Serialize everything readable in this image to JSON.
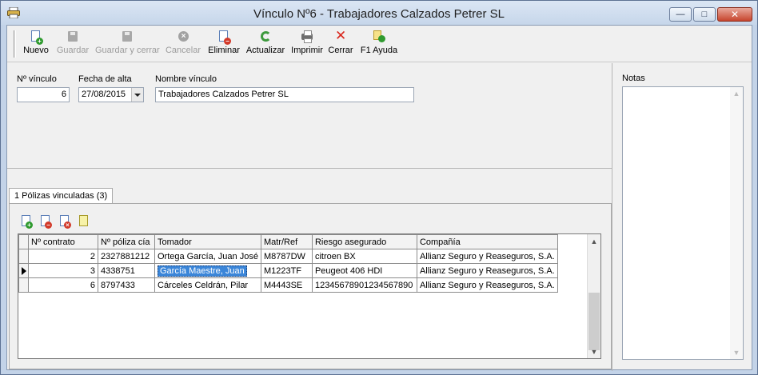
{
  "window": {
    "title": "Vínculo Nº6 - Trabajadores Calzados Petrer SL",
    "minimize_icon": "minimize-icon",
    "maximize_icon": "maximize-icon",
    "close_icon": "close-icon"
  },
  "toolbar": {
    "buttons": [
      {
        "key": "nuevo",
        "label": "Nuevo",
        "icon": "new-document-icon",
        "enabled": true
      },
      {
        "key": "guardar",
        "label": "Guardar",
        "icon": "save-icon",
        "enabled": false
      },
      {
        "key": "guardar_cerrar",
        "label": "Guardar y cerrar",
        "icon": "save-close-icon",
        "enabled": false
      },
      {
        "key": "cancelar",
        "label": "Cancelar",
        "icon": "cancel-icon",
        "enabled": false
      },
      {
        "key": "eliminar",
        "label": "Eliminar",
        "icon": "delete-document-icon",
        "enabled": true
      },
      {
        "key": "actualizar",
        "label": "Actualizar",
        "icon": "refresh-icon",
        "enabled": true
      },
      {
        "key": "imprimir",
        "label": "Imprimir",
        "icon": "printer-icon",
        "enabled": true
      },
      {
        "key": "cerrar",
        "label": "Cerrar",
        "icon": "close-red-x-icon",
        "enabled": true
      },
      {
        "key": "ayuda",
        "label": "F1 Ayuda",
        "icon": "help-icon",
        "enabled": true
      }
    ]
  },
  "form": {
    "num_vinculo_label": "Nº vínculo",
    "num_vinculo_value": "6",
    "fecha_alta_label": "Fecha de alta",
    "fecha_alta_value": "27/08/2015",
    "nombre_label": "Nombre vínculo",
    "nombre_value": "Trabajadores Calzados Petrer SL"
  },
  "notes": {
    "label": "Notas"
  },
  "tab": {
    "label": "1 Pólizas vinculadas (3)"
  },
  "grid": {
    "columns": [
      "Nº contrato",
      "Nº póliza cía",
      "Tomador",
      "Matr/Ref",
      "Riesgo asegurado",
      "Compañía"
    ],
    "rows": [
      [
        "2",
        "2327881212",
        "Ortega García, Juan José",
        "M8787DW",
        "citroen BX",
        "Allianz Seguro y Reaseguros, S.A."
      ],
      [
        "3",
        "4338751",
        "García Maestre, Juan",
        "M1223TF",
        "Peugeot 406 HDI",
        "Allianz Seguro y Reaseguros, S.A."
      ],
      [
        "6",
        "8797433",
        "Cárceles Celdrán, Pilar",
        "M4443SE",
        "12345678901234567890",
        "Allianz Seguro y Reaseguros, S.A."
      ]
    ],
    "current_row": 1
  }
}
